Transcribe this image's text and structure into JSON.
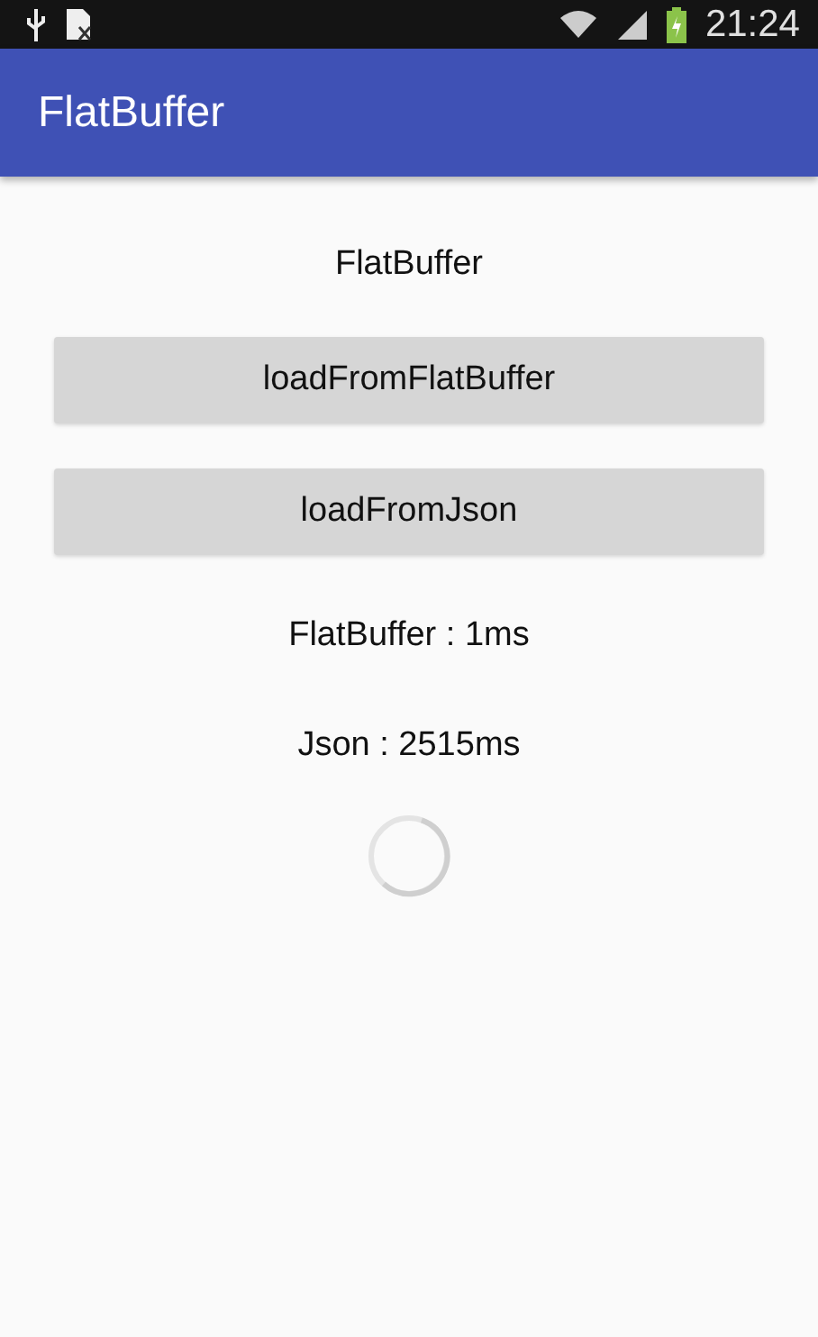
{
  "status_bar": {
    "time": "21:24"
  },
  "app_bar": {
    "title": "FlatBuffer"
  },
  "heading": "FlatBuffer",
  "buttons": [
    "loadFromFlatBuffer",
    "loadFromJson"
  ],
  "results": [
    "FlatBuffer : 1ms",
    "Json : 2515ms"
  ]
}
